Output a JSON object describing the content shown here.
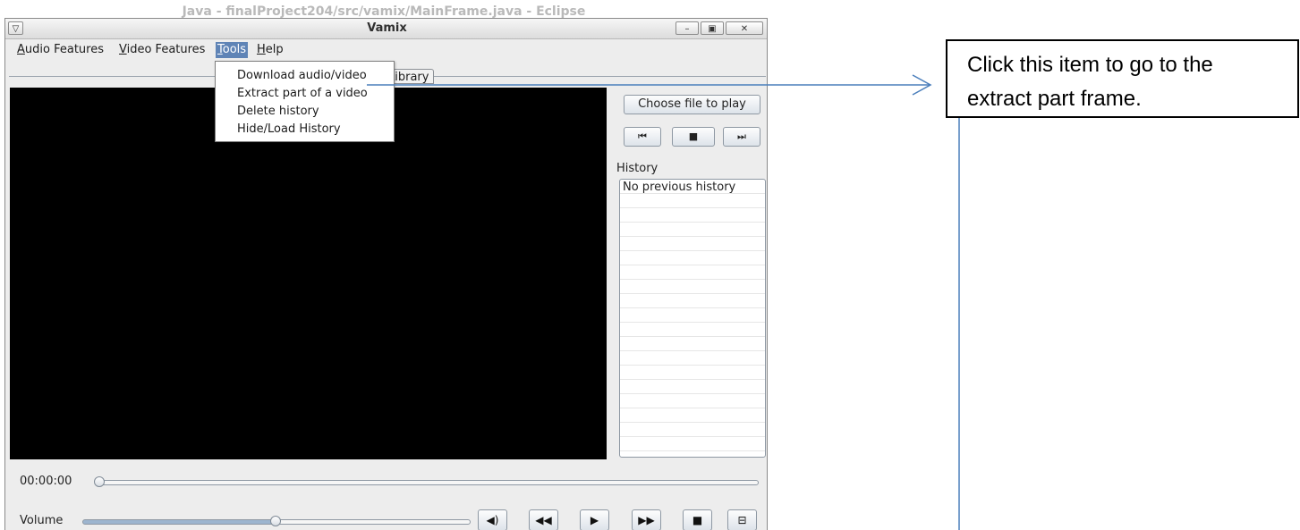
{
  "background_window": {
    "title": "Java - finalProject204/src/vamix/MainFrame.java - Eclipse"
  },
  "window": {
    "title": "Vamix",
    "system_menu_icon": "window-menu-icon",
    "controls": [
      "minimize-icon",
      "maximize-icon",
      "close-icon"
    ]
  },
  "menubar": {
    "items": [
      {
        "label": "Audio Features",
        "mnemonic": "A"
      },
      {
        "label": "Video Features",
        "mnemonic": "V"
      },
      {
        "label": "Tools",
        "mnemonic": "T",
        "active": true
      },
      {
        "label": "Help",
        "mnemonic": "H"
      }
    ]
  },
  "tools_menu": {
    "items": [
      {
        "label": "Download audio/video"
      },
      {
        "label": "Extract part of a video"
      },
      {
        "label": "Delete history"
      },
      {
        "label": "Hide/Load History"
      }
    ]
  },
  "tabs": {
    "partial_label": "Library"
  },
  "side_panel": {
    "choose_file_label": "Choose file to play",
    "nav_buttons": [
      "skip-back-icon",
      "camera-icon",
      "skip-forward-icon"
    ],
    "history_label": "History",
    "history_items": [
      "No previous history"
    ]
  },
  "player": {
    "time": "00:00:00",
    "seek_fraction": 0.0,
    "volume_label": "Volume",
    "volume_fraction": 0.51,
    "controls": [
      "volume-icon",
      "rewind-icon",
      "play-icon",
      "fast-forward-icon",
      "stop-icon",
      "fullscreen-icon"
    ]
  },
  "callout": {
    "text": "Click this item to go to the extract part frame."
  },
  "colors": {
    "menu_highlight": "#5f84b6",
    "annotation_line": "#4a7ebb",
    "video_bg": "#000000"
  }
}
